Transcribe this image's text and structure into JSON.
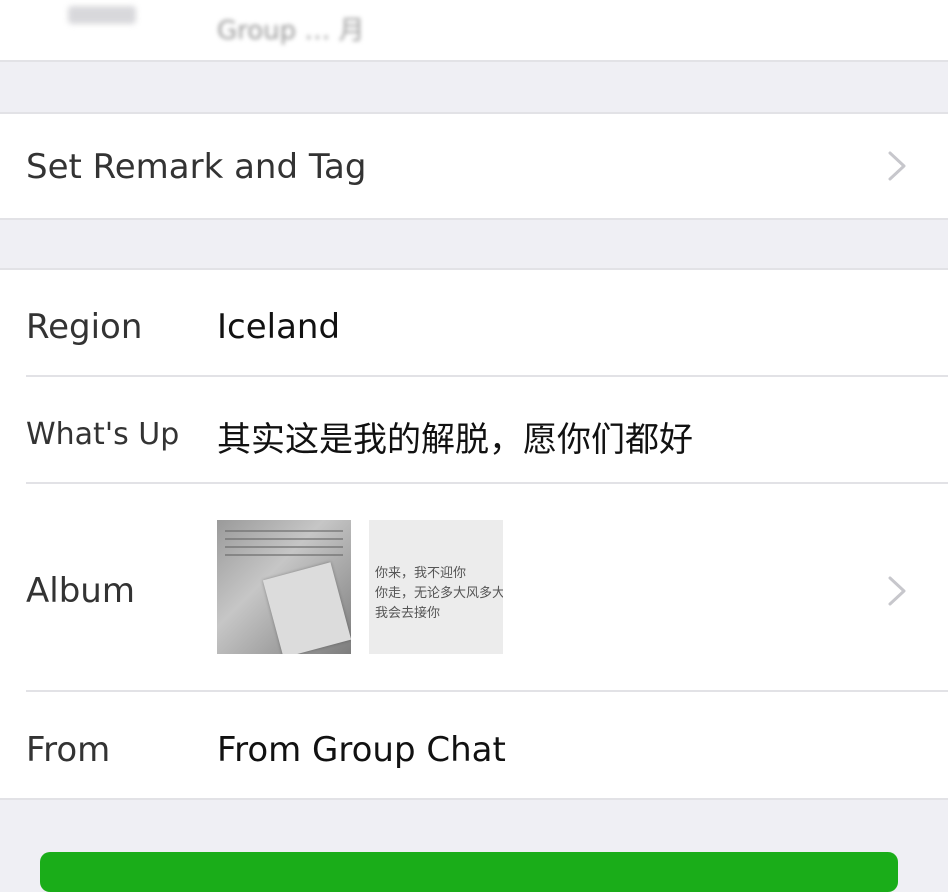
{
  "profile": {
    "group_line_blurred": "Group … 月"
  },
  "remark": {
    "label": "Set Remark and Tag"
  },
  "details": {
    "region_label": "Region",
    "region_value": "Iceland",
    "whatsup_label": "What's Up",
    "whatsup_value": "其实这是我的解脱，愿你们都好",
    "album_label": "Album",
    "album_thumb2_text": [
      "你来，我不迎你",
      "你走，无论多大风多大",
      "我会去接你"
    ],
    "from_label": "From",
    "from_value": "From Group Chat"
  },
  "colors": {
    "background": "#efeff4",
    "panel": "#ffffff",
    "primary_button": "#1aad19",
    "chevron": "#c7c7cc"
  },
  "icons": {
    "row_disclosure": "chevron-right-icon"
  }
}
